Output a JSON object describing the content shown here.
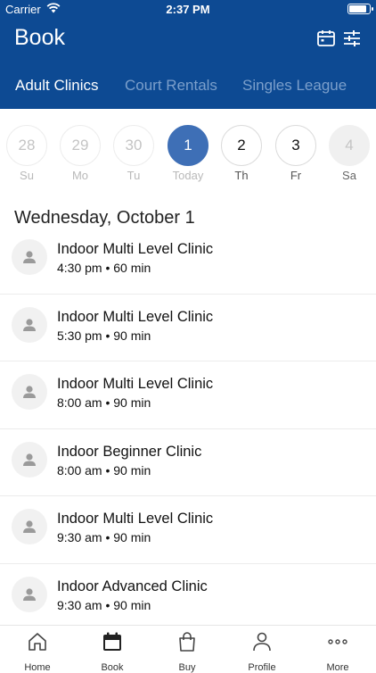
{
  "status_bar": {
    "carrier": "Carrier",
    "time": "2:37 PM"
  },
  "header": {
    "title": "Book",
    "icons": [
      "calendar-icon",
      "filter-sliders-icon"
    ],
    "tabs": [
      "Adult Clinics",
      "Court Rentals",
      "Singles League"
    ],
    "active_tab": "Adult Clinics",
    "background_color": "#0d4a93"
  },
  "date_strip": {
    "days": [
      {
        "num": "28",
        "dow": "Su",
        "state": "past"
      },
      {
        "num": "29",
        "dow": "Mo",
        "state": "past"
      },
      {
        "num": "30",
        "dow": "Tu",
        "state": "past"
      },
      {
        "num": "1",
        "dow": "Today",
        "state": "selected"
      },
      {
        "num": "2",
        "dow": "Th",
        "state": "future"
      },
      {
        "num": "3",
        "dow": "Fr",
        "state": "future"
      },
      {
        "num": "4",
        "dow": "Sa",
        "state": "disabled"
      }
    ],
    "selected_color": "#3e6fb6"
  },
  "day_heading": "Wednesday, October 1",
  "sessions": [
    {
      "name": "Indoor Multi Level Clinic",
      "meta": "4:30 pm • 60 min"
    },
    {
      "name": "Indoor Multi Level Clinic",
      "meta": "5:30 pm • 90 min"
    },
    {
      "name": "Indoor Multi Level Clinic",
      "meta": "8:00 am • 90 min"
    },
    {
      "name": "Indoor Beginner Clinic",
      "meta": "8:00 am • 90 min"
    },
    {
      "name": "Indoor Multi Level Clinic",
      "meta": "9:30 am • 90 min"
    },
    {
      "name": "Indoor Advanced Clinic",
      "meta": "9:30 am • 90 min"
    }
  ],
  "tab_bar": {
    "items": [
      {
        "label": "Home",
        "icon": "home-icon"
      },
      {
        "label": "Book",
        "icon": "calendar-icon",
        "active": true
      },
      {
        "label": "Buy",
        "icon": "shopping-bag-icon"
      },
      {
        "label": "Profile",
        "icon": "person-icon"
      },
      {
        "label": "More",
        "icon": "more-dots-icon"
      }
    ]
  }
}
